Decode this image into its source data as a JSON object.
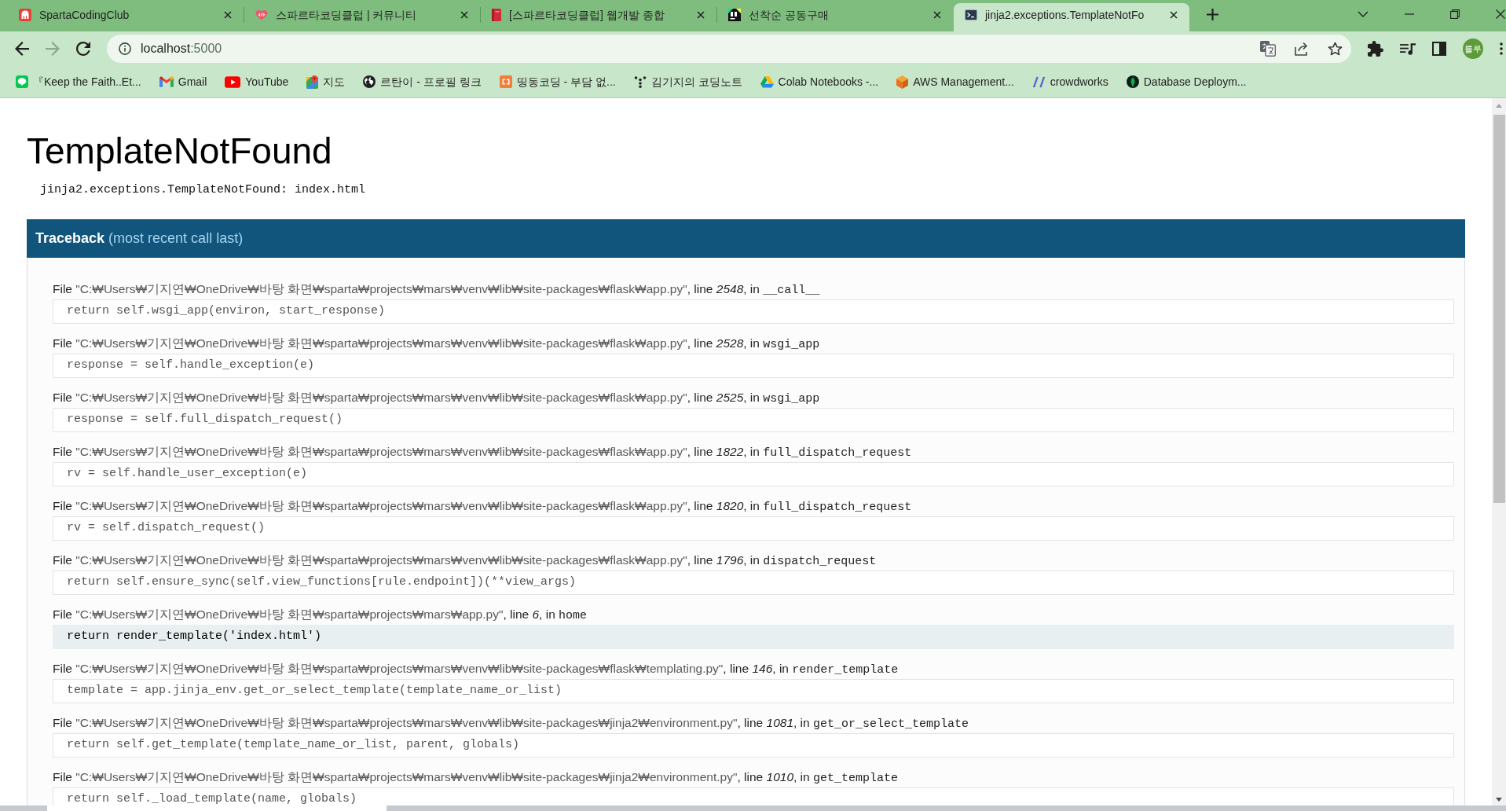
{
  "browser": {
    "tabs": [
      {
        "title": "SpartaCodingClub",
        "selected": false
      },
      {
        "title": "스파르타코딩클럽 | 커뮤니티",
        "selected": false
      },
      {
        "title": "[스파르타코딩클럽] 웹개발 종합",
        "selected": false
      },
      {
        "title": "선착순 공동구매",
        "selected": false
      },
      {
        "title": "jinja2.exceptions.TemplateNotFo",
        "selected": true
      }
    ],
    "toolbar": {
      "forward_disabled": true,
      "address": {
        "host": "localhost",
        "port": ":5000"
      },
      "profile": "룰루"
    },
    "bookmarks": [
      "『Keep the Faith..Et...",
      "Gmail",
      "YouTube",
      "지도",
      "르탄이 - 프로필 링크",
      "띵동코딩 - 부담 없...",
      "김기지의 코딩노트",
      "Colab Notebooks -...",
      "AWS Management...",
      "crowdworks",
      "Database Deploym..."
    ]
  },
  "page": {
    "title": "TemplateNotFound",
    "error_message": "jinja2.exceptions.TemplateNotFound: index.html",
    "traceback": {
      "title": "Traceback",
      "subtitle": "(most recent call last)",
      "frames": [
        {
          "location": {
            "prefix": "File",
            "path": "\"C:₩Users₩기지연₩OneDrive₩바탕 화면₩sparta₩projects₩mars₩venv₩lib₩site-packages₩flask₩app.py\"",
            "line_label": ", line",
            "line": "2548",
            "function_label": ", in",
            "function": "__call__"
          },
          "source": "return self.wsgi_app(environ, start_response)",
          "library": true
        },
        {
          "location": {
            "prefix": "File",
            "path": "\"C:₩Users₩기지연₩OneDrive₩바탕 화면₩sparta₩projects₩mars₩venv₩lib₩site-packages₩flask₩app.py\"",
            "line_label": ", line",
            "line": "2528",
            "function_label": ", in",
            "function": "wsgi_app"
          },
          "source": "response = self.handle_exception(e)",
          "library": true
        },
        {
          "location": {
            "prefix": "File",
            "path": "\"C:₩Users₩기지연₩OneDrive₩바탕 화면₩sparta₩projects₩mars₩venv₩lib₩site-packages₩flask₩app.py\"",
            "line_label": ", line",
            "line": "2525",
            "function_label": ", in",
            "function": "wsgi_app"
          },
          "source": "response = self.full_dispatch_request()",
          "library": true
        },
        {
          "location": {
            "prefix": "File",
            "path": "\"C:₩Users₩기지연₩OneDrive₩바탕 화면₩sparta₩projects₩mars₩venv₩lib₩site-packages₩flask₩app.py\"",
            "line_label": ", line",
            "line": "1822",
            "function_label": ", in",
            "function": "full_dispatch_request"
          },
          "source": "rv = self.handle_user_exception(e)",
          "library": true
        },
        {
          "location": {
            "prefix": "File",
            "path": "\"C:₩Users₩기지연₩OneDrive₩바탕 화면₩sparta₩projects₩mars₩venv₩lib₩site-packages₩flask₩app.py\"",
            "line_label": ", line",
            "line": "1820",
            "function_label": ", in",
            "function": "full_dispatch_request"
          },
          "source": "rv = self.dispatch_request()",
          "library": true
        },
        {
          "location": {
            "prefix": "File",
            "path": "\"C:₩Users₩기지연₩OneDrive₩바탕 화면₩sparta₩projects₩mars₩venv₩lib₩site-packages₩flask₩app.py\"",
            "line_label": ", line",
            "line": "1796",
            "function_label": ", in",
            "function": "dispatch_request"
          },
          "source": "return self.ensure_sync(self.view_functions[rule.endpoint])(**view_args)",
          "library": true
        },
        {
          "location": {
            "prefix": "File",
            "path": "\"C:₩Users₩기지연₩OneDrive₩바탕 화면₩sparta₩projects₩mars₩app.py\"",
            "line_label": ", line",
            "line": "6",
            "function_label": ", in",
            "function": "home"
          },
          "source": "return render_template('index.html')",
          "library": false
        },
        {
          "location": {
            "prefix": "File",
            "path": "\"C:₩Users₩기지연₩OneDrive₩바탕 화면₩sparta₩projects₩mars₩venv₩lib₩site-packages₩flask₩templating.py\"",
            "line_label": ", line",
            "line": "146",
            "function_label": ", in",
            "function": "render_template"
          },
          "source": "template = app.jinja_env.get_or_select_template(template_name_or_list)",
          "library": true
        },
        {
          "location": {
            "prefix": "File",
            "path": "\"C:₩Users₩기지연₩OneDrive₩바탕 화면₩sparta₩projects₩mars₩venv₩lib₩site-packages₩jinja2₩environment.py\"",
            "line_label": ", line",
            "line": "1081",
            "function_label": ", in",
            "function": "get_or_select_template"
          },
          "source": "return self.get_template(template_name_or_list, parent, globals)",
          "library": true
        },
        {
          "location": {
            "prefix": "File",
            "path": "\"C:₩Users₩기지연₩OneDrive₩바탕 화면₩sparta₩projects₩mars₩venv₩lib₩site-packages₩jinja2₩environment.py\"",
            "line_label": ", line",
            "line": "1010",
            "function_label": ", in",
            "function": "get_template"
          },
          "source": "return self._load_template(name, globals)",
          "library": true
        }
      ]
    }
  }
}
